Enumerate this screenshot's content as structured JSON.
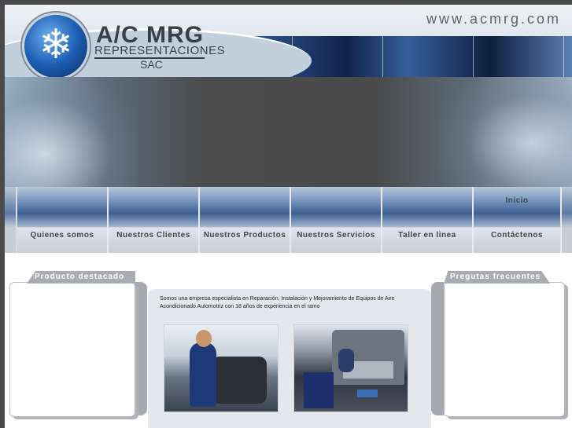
{
  "header": {
    "brand_name": "A/C MRG",
    "brand_subtitle": "REPRESENTACIONES",
    "brand_suffix": "SAC",
    "website": "www.acmrg.com"
  },
  "nav": {
    "items": [
      {
        "label": "Quienes somos"
      },
      {
        "label": "Nuestros Clientes"
      },
      {
        "label": "Nuestros Productos"
      },
      {
        "label": "Nuestros Servicios"
      },
      {
        "label": "Taller en linea"
      },
      {
        "label": "Contáctenos"
      }
    ],
    "home_label": "Inicio"
  },
  "left_panel": {
    "title": "Producto destacado"
  },
  "right_panel": {
    "title": "Pregutas frecuentes"
  },
  "main": {
    "intro": "Somos una empresa especialista en Reparación, Instalación y Mejoramiento de Equipos de Aire Acondicionado Automotriz con 18 años de experiencia en el ramo"
  }
}
